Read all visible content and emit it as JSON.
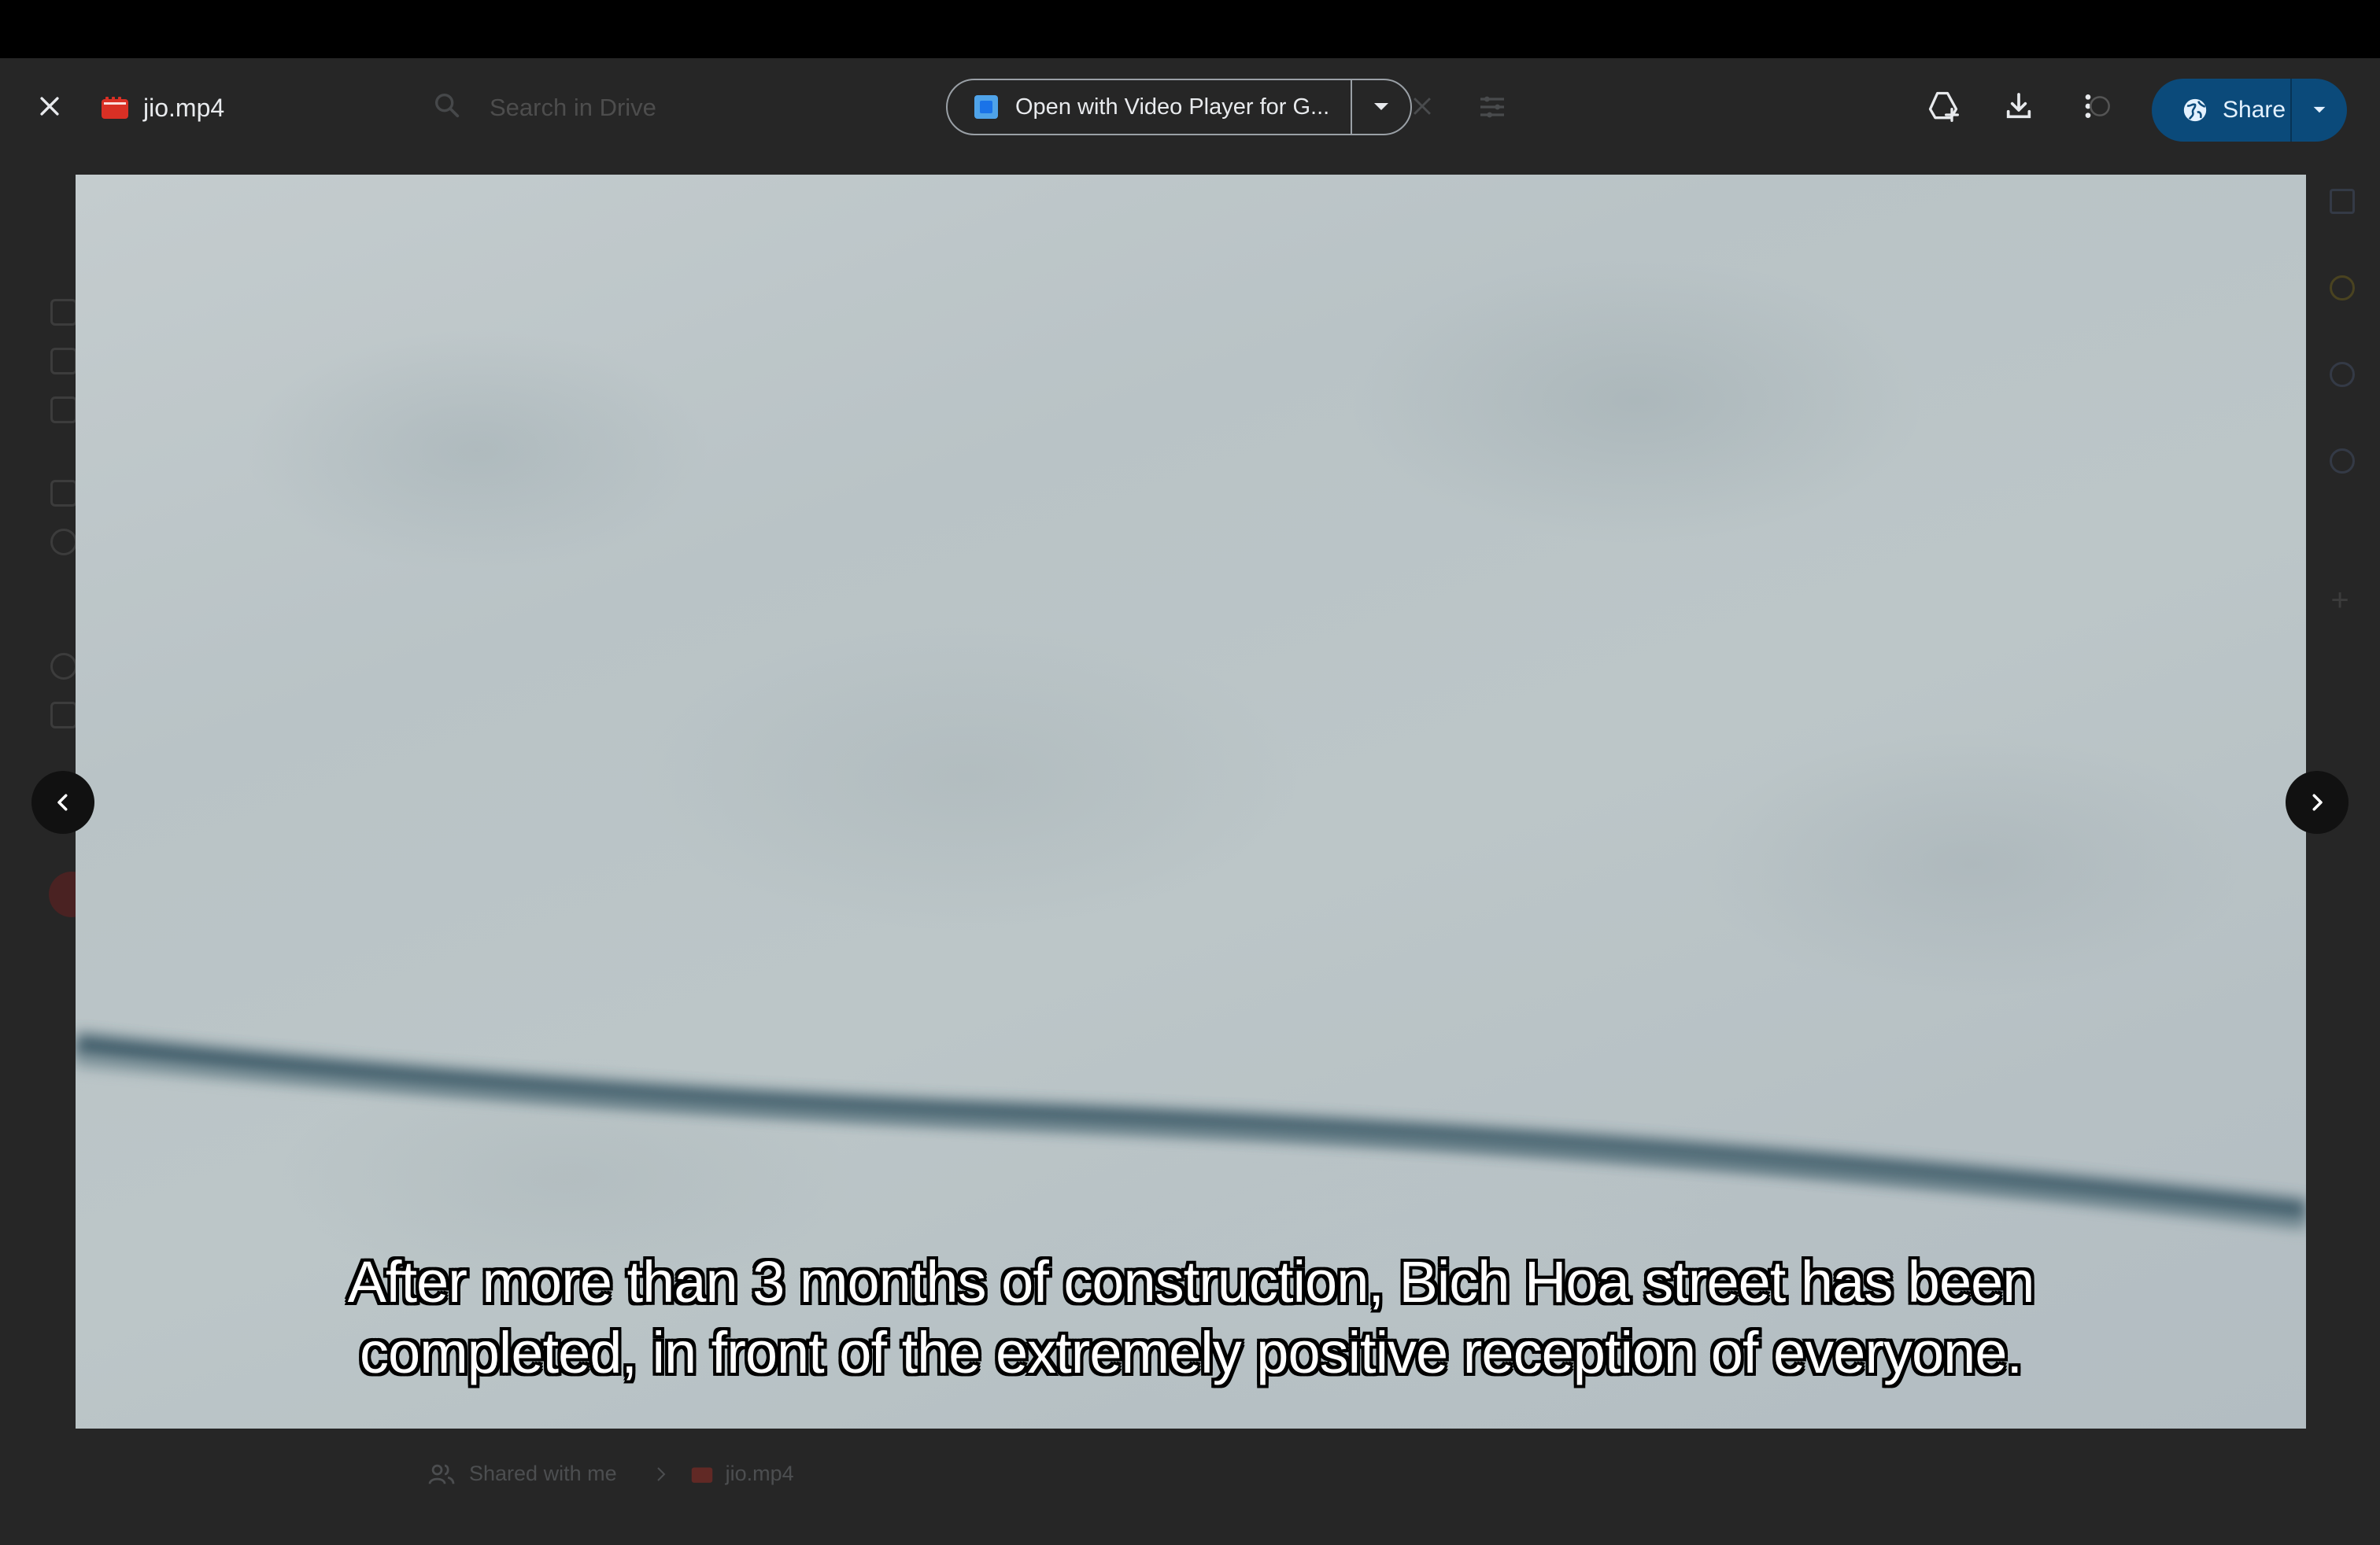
{
  "file": {
    "name": "jio.mp4",
    "icon": "video-file-icon",
    "icon_color": "#d93025"
  },
  "search": {
    "placeholder": "Search in Drive"
  },
  "open_with": {
    "label": "Open with Video Player for G...",
    "app_icon_color": "#4fa3e9"
  },
  "toolbar": {
    "add_to_drive_icon": "add-to-drive-icon",
    "download_icon": "download-icon",
    "more_icon": "more-vert-icon",
    "share_label": "Share",
    "share_color": "#0b4a7a"
  },
  "video": {
    "subtitle_line1": "After more than 3 months of construction, Bich Hoa street has been",
    "subtitle_line2": "completed, in front of the extremely positive reception of everyone."
  },
  "breadcrumb": {
    "location": "Shared with me",
    "file": "jio.mp4"
  }
}
